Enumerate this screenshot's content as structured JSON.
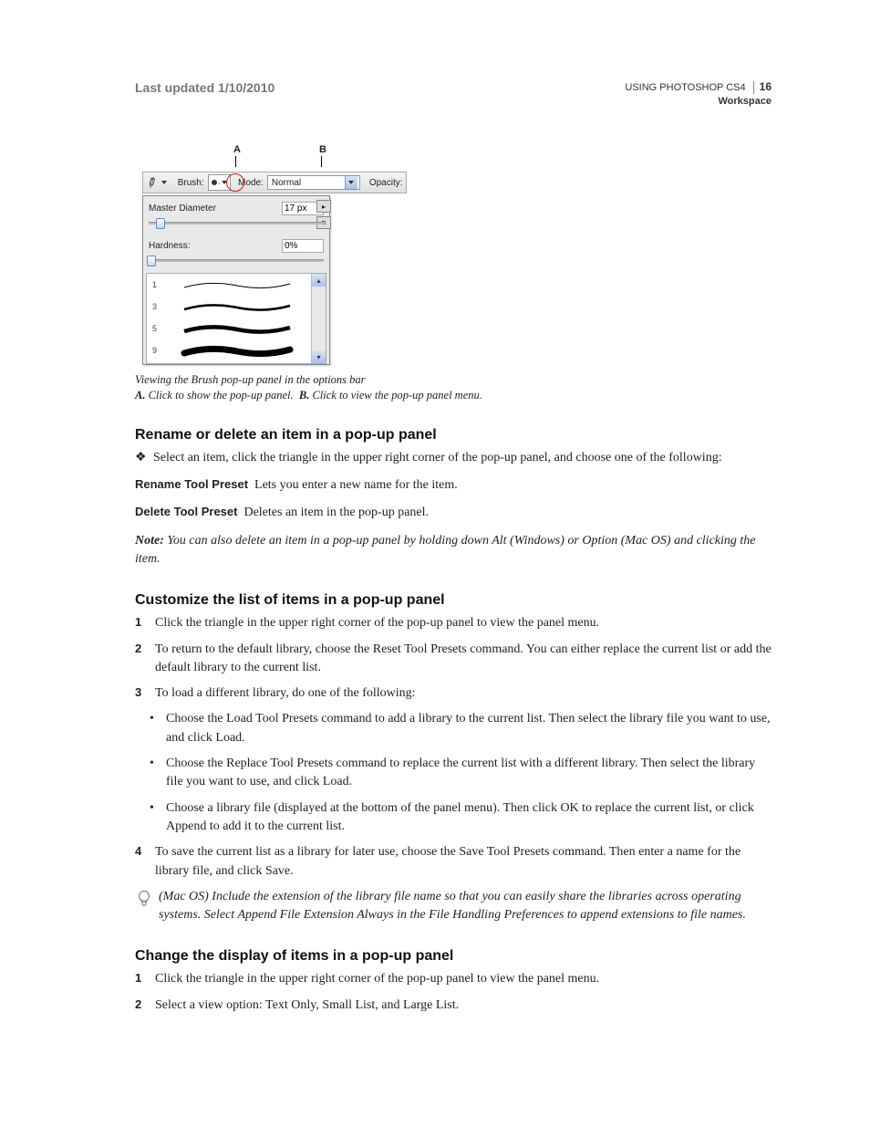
{
  "header": {
    "last_updated": "Last updated 1/10/2010",
    "title": "USING PHOTOSHOP CS4",
    "section": "Workspace",
    "page_num": "16"
  },
  "figure": {
    "label_A": "A",
    "label_B": "B",
    "toolbar": {
      "brush_label": "Brush:",
      "mode_label": "Mode:",
      "mode_value": "Normal",
      "opacity_label": "Opacity:"
    },
    "panel": {
      "diameter_label": "Master Diameter",
      "diameter_value": "17 px",
      "hardness_label": "Hardness:",
      "hardness_value": "0%",
      "brush_sizes": [
        "1",
        "3",
        "5",
        "9"
      ]
    },
    "caption_main": "Viewing the Brush pop-up panel in the options bar",
    "caption_A_label": "A.",
    "caption_A": "Click to show the pop-up panel.",
    "caption_B_label": "B.",
    "caption_B": "Click to view the pop-up panel menu."
  },
  "sec1": {
    "title": "Rename or delete an item in a pop-up panel",
    "bullet": "Select an item, click the triangle in the upper right corner of the pop-up panel, and choose one of the following:",
    "rename_term": "Rename Tool Preset",
    "rename_desc": "Lets you enter a new name for the item.",
    "delete_term": "Delete Tool Preset",
    "delete_desc": "Deletes an item in the pop-up panel.",
    "note_label": "Note:",
    "note_text": "You can also delete an item in a pop-up panel by holding down Alt (Windows) or Option (Mac OS) and clicking the item."
  },
  "sec2": {
    "title": "Customize the list of items in a pop-up panel",
    "step1": "Click the triangle in the upper right corner of the pop-up panel to view the panel menu.",
    "step2": "To return to the default library, choose the Reset Tool Presets command. You can either replace the current list or add the default library to the current list.",
    "step3": "To load a different library, do one of the following:",
    "sub1": "Choose the Load Tool Presets command to add a library to the current list. Then select the library file you want to use, and click Load.",
    "sub2": "Choose the Replace Tool Presets command to replace the current list with a different library. Then select the library file you want to use, and click Load.",
    "sub3": "Choose a library file (displayed at the bottom of the panel menu). Then click OK to replace the current list, or click Append to add it to the current list.",
    "step4": "To save the current list as a library for later use, choose the Save Tool Presets command. Then enter a name for the library file, and click Save.",
    "tip": "(Mac OS) Include the extension of the library file name so that you can easily share the libraries across operating systems. Select Append File Extension Always in the File Handling Preferences to append extensions to file names."
  },
  "sec3": {
    "title": "Change the display of items in a pop-up panel",
    "step1": "Click the triangle in the upper right corner of the pop-up panel to view the panel menu.",
    "step2": "Select a view option: Text Only, Small List, and Large List."
  }
}
